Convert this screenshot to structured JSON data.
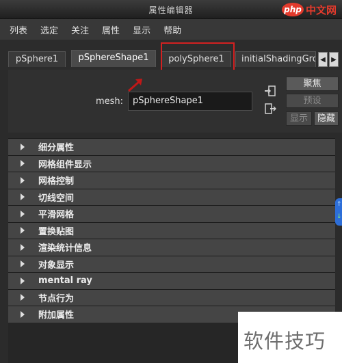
{
  "window": {
    "title": "属性编辑器"
  },
  "watermark": {
    "logo_text": "php",
    "logo_suffix": "中文网",
    "bottom_text": "软件技巧",
    "logo_color": "#e33a2c"
  },
  "menu": [
    "列表",
    "选定",
    "关注",
    "属性",
    "显示",
    "帮助"
  ],
  "tabs": [
    {
      "label": "pSphere1",
      "active": false
    },
    {
      "label": "pSphereShape1",
      "active": true
    },
    {
      "label": "polySphere1",
      "active": false,
      "highlighted": true
    },
    {
      "label": "initialShadingGrou",
      "active": false
    }
  ],
  "tab_scroll": {
    "left_glyph": "◀",
    "right_glyph": "▶"
  },
  "mesh": {
    "label": "mesh:",
    "value": "pSphereShape1"
  },
  "buttons": {
    "focus": "聚焦",
    "preset": "预设",
    "show": "显示",
    "hide": "隐藏"
  },
  "sections": [
    "细分属性",
    "网格组件显示",
    "网格控制",
    "切线空间",
    "平滑网格",
    "置换贴图",
    "渲染统计信息",
    "对象显示",
    "mental ray",
    "节点行为",
    "附加属性"
  ],
  "side_widget": {
    "up_glyph": "↑",
    "down_glyph": "↓"
  },
  "colors": {
    "highlight": "#d42121",
    "background": "#2b2b2b",
    "section": "#454545"
  }
}
